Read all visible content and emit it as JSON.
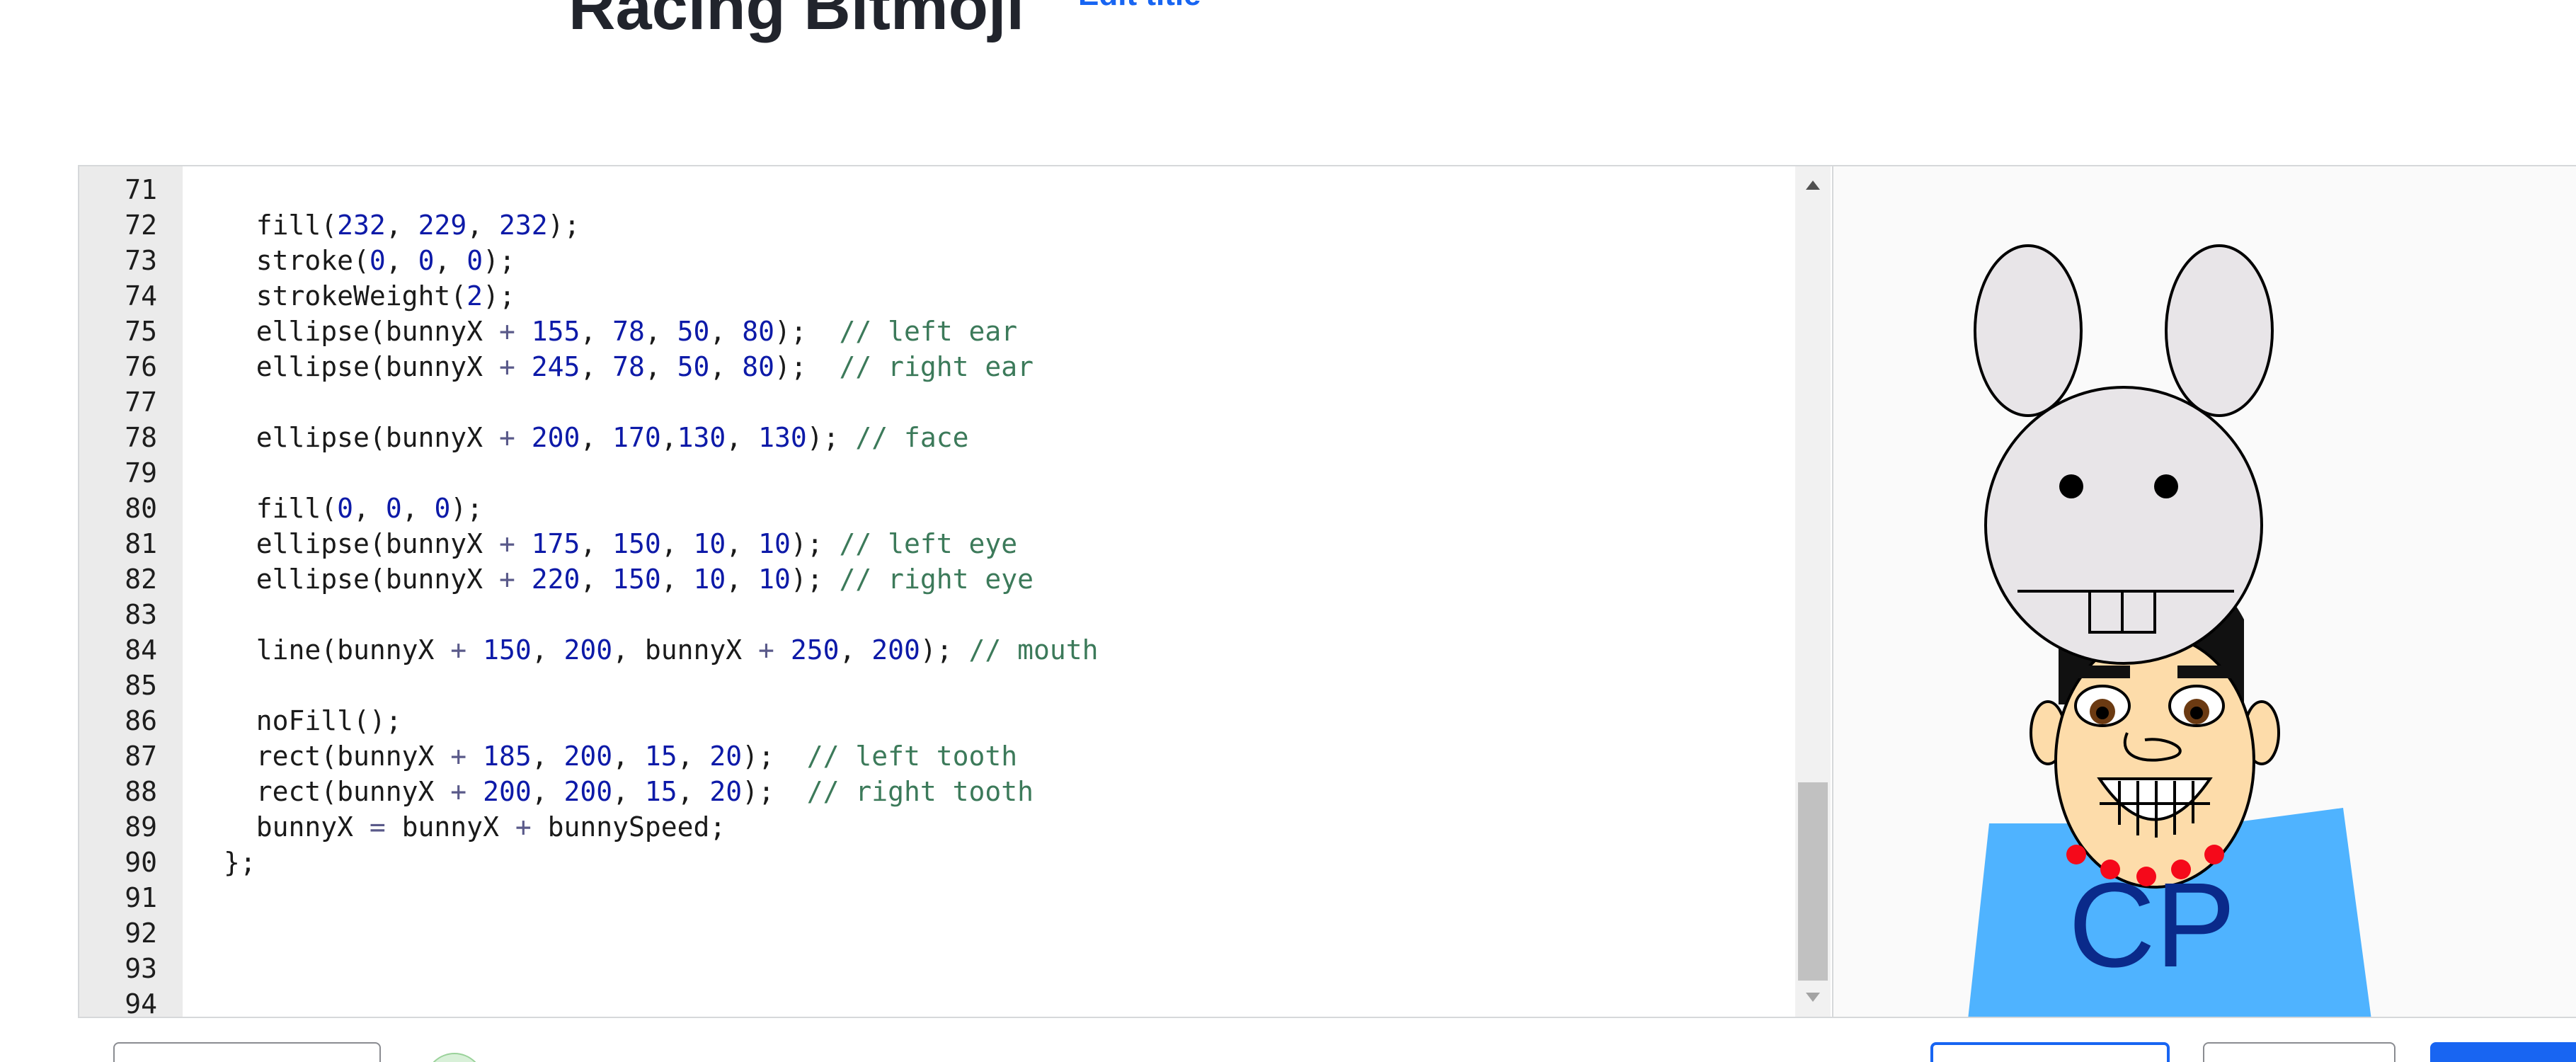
{
  "header": {
    "title": "Racing Bitmoji",
    "edit_title_label": "Edit title"
  },
  "editor": {
    "lines": [
      {
        "no": "71",
        "tokens": []
      },
      {
        "no": "72",
        "tokens": [
          [
            "t",
            "  fill("
          ],
          [
            "n",
            "232"
          ],
          [
            "t",
            ", "
          ],
          [
            "n",
            "229"
          ],
          [
            "t",
            ", "
          ],
          [
            "n",
            "232"
          ],
          [
            "t",
            ");"
          ]
        ]
      },
      {
        "no": "73",
        "tokens": [
          [
            "t",
            "  stroke("
          ],
          [
            "n",
            "0"
          ],
          [
            "t",
            ", "
          ],
          [
            "n",
            "0"
          ],
          [
            "t",
            ", "
          ],
          [
            "n",
            "0"
          ],
          [
            "t",
            ");"
          ]
        ]
      },
      {
        "no": "74",
        "tokens": [
          [
            "t",
            "  strokeWeight("
          ],
          [
            "n",
            "2"
          ],
          [
            "t",
            ");"
          ]
        ]
      },
      {
        "no": "75",
        "tokens": [
          [
            "t",
            "  ellipse(bunnyX "
          ],
          [
            "o",
            "+"
          ],
          [
            "t",
            " "
          ],
          [
            "n",
            "155"
          ],
          [
            "t",
            ", "
          ],
          [
            "n",
            "78"
          ],
          [
            "t",
            ", "
          ],
          [
            "n",
            "50"
          ],
          [
            "t",
            ", "
          ],
          [
            "n",
            "80"
          ],
          [
            "t",
            ");  "
          ],
          [
            "c",
            "// left ear"
          ]
        ]
      },
      {
        "no": "76",
        "tokens": [
          [
            "t",
            "  ellipse(bunnyX "
          ],
          [
            "o",
            "+"
          ],
          [
            "t",
            " "
          ],
          [
            "n",
            "245"
          ],
          [
            "t",
            ", "
          ],
          [
            "n",
            "78"
          ],
          [
            "t",
            ", "
          ],
          [
            "n",
            "50"
          ],
          [
            "t",
            ", "
          ],
          [
            "n",
            "80"
          ],
          [
            "t",
            ");  "
          ],
          [
            "c",
            "// right ear"
          ]
        ]
      },
      {
        "no": "77",
        "tokens": []
      },
      {
        "no": "78",
        "tokens": [
          [
            "t",
            "  ellipse(bunnyX "
          ],
          [
            "o",
            "+"
          ],
          [
            "t",
            " "
          ],
          [
            "n",
            "200"
          ],
          [
            "t",
            ", "
          ],
          [
            "n",
            "170"
          ],
          [
            "t",
            ","
          ],
          [
            "n",
            "130"
          ],
          [
            "t",
            ", "
          ],
          [
            "n",
            "130"
          ],
          [
            "t",
            "); "
          ],
          [
            "c",
            "// face"
          ]
        ]
      },
      {
        "no": "79",
        "tokens": []
      },
      {
        "no": "80",
        "tokens": [
          [
            "t",
            "  fill("
          ],
          [
            "n",
            "0"
          ],
          [
            "t",
            ", "
          ],
          [
            "n",
            "0"
          ],
          [
            "t",
            ", "
          ],
          [
            "n",
            "0"
          ],
          [
            "t",
            ");"
          ]
        ]
      },
      {
        "no": "81",
        "tokens": [
          [
            "t",
            "  ellipse(bunnyX "
          ],
          [
            "o",
            "+"
          ],
          [
            "t",
            " "
          ],
          [
            "n",
            "175"
          ],
          [
            "t",
            ", "
          ],
          [
            "n",
            "150"
          ],
          [
            "t",
            ", "
          ],
          [
            "n",
            "10"
          ],
          [
            "t",
            ", "
          ],
          [
            "n",
            "10"
          ],
          [
            "t",
            "); "
          ],
          [
            "c",
            "// left eye"
          ]
        ]
      },
      {
        "no": "82",
        "tokens": [
          [
            "t",
            "  ellipse(bunnyX "
          ],
          [
            "o",
            "+"
          ],
          [
            "t",
            " "
          ],
          [
            "n",
            "220"
          ],
          [
            "t",
            ", "
          ],
          [
            "n",
            "150"
          ],
          [
            "t",
            ", "
          ],
          [
            "n",
            "10"
          ],
          [
            "t",
            ", "
          ],
          [
            "n",
            "10"
          ],
          [
            "t",
            "); "
          ],
          [
            "c",
            "// right eye"
          ]
        ]
      },
      {
        "no": "83",
        "tokens": []
      },
      {
        "no": "84",
        "tokens": [
          [
            "t",
            "  line(bunnyX "
          ],
          [
            "o",
            "+"
          ],
          [
            "t",
            " "
          ],
          [
            "n",
            "150"
          ],
          [
            "t",
            ", "
          ],
          [
            "n",
            "200"
          ],
          [
            "t",
            ", bunnyX "
          ],
          [
            "o",
            "+"
          ],
          [
            "t",
            " "
          ],
          [
            "n",
            "250"
          ],
          [
            "t",
            ", "
          ],
          [
            "n",
            "200"
          ],
          [
            "t",
            "); "
          ],
          [
            "c",
            "// mouth"
          ]
        ]
      },
      {
        "no": "85",
        "tokens": []
      },
      {
        "no": "86",
        "tokens": [
          [
            "t",
            "  noFill();"
          ]
        ]
      },
      {
        "no": "87",
        "tokens": [
          [
            "t",
            "  rect(bunnyX "
          ],
          [
            "o",
            "+"
          ],
          [
            "t",
            " "
          ],
          [
            "n",
            "185"
          ],
          [
            "t",
            ", "
          ],
          [
            "n",
            "200"
          ],
          [
            "t",
            ", "
          ],
          [
            "n",
            "15"
          ],
          [
            "t",
            ", "
          ],
          [
            "n",
            "20"
          ],
          [
            "t",
            ");  "
          ],
          [
            "c",
            "// left tooth"
          ]
        ]
      },
      {
        "no": "88",
        "tokens": [
          [
            "t",
            "  rect(bunnyX "
          ],
          [
            "o",
            "+"
          ],
          [
            "t",
            " "
          ],
          [
            "n",
            "200"
          ],
          [
            "t",
            ", "
          ],
          [
            "n",
            "200"
          ],
          [
            "t",
            ", "
          ],
          [
            "n",
            "15"
          ],
          [
            "t",
            ", "
          ],
          [
            "n",
            "20"
          ],
          [
            "t",
            ");  "
          ],
          [
            "c",
            "// right tooth"
          ]
        ]
      },
      {
        "no": "89",
        "tokens": [
          [
            "t",
            "  bunnyX "
          ],
          [
            "o",
            "="
          ],
          [
            "t",
            " bunnyX "
          ],
          [
            "o",
            "+"
          ],
          [
            "t",
            " bunnySpeed;"
          ]
        ]
      },
      {
        "no": "90",
        "tokens": [
          [
            "t",
            "};"
          ]
        ]
      },
      {
        "no": "91",
        "tokens": []
      },
      {
        "no": "92",
        "tokens": []
      },
      {
        "no": "93",
        "tokens": []
      },
      {
        "no": "94",
        "tokens": []
      }
    ]
  },
  "canvas": {
    "shirt_text": "CP",
    "colors": {
      "bunny_fill": "#e8e5e8",
      "skin": "#fddcaa",
      "shirt": "#4fb3ff",
      "shirt_text": "#0a2a8a",
      "beads": "#f5091a",
      "background": "#fafafa"
    }
  },
  "colors": {
    "accent": "#1865f2",
    "number_token": "#0d1aa8",
    "comment_token": "#3c7a5a"
  }
}
